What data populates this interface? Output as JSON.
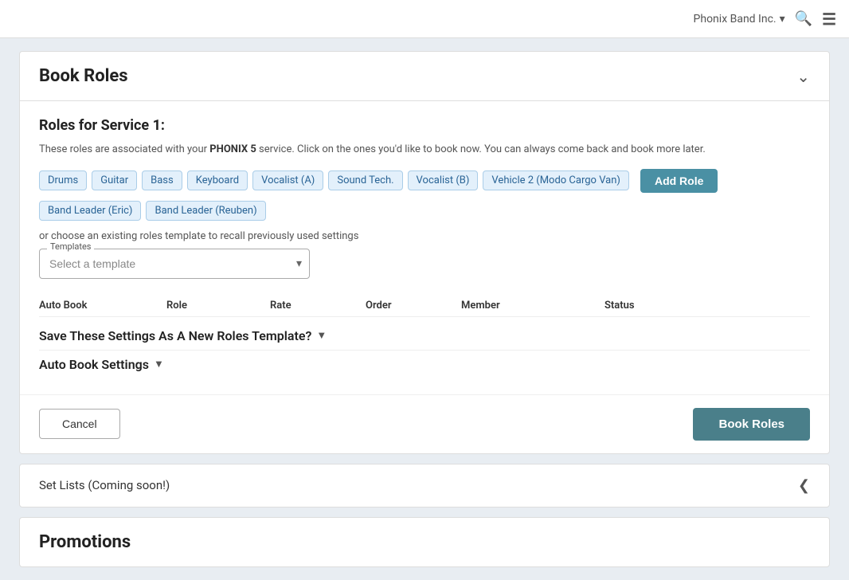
{
  "topNav": {
    "brand": "Phonix Band Inc.",
    "dropdownArrow": "▾",
    "searchIconLabel": "search",
    "menuIconLabel": "menu"
  },
  "bookRoles": {
    "cardTitle": "Book Roles",
    "sectionTitle": "Roles for Service 1:",
    "description": {
      "prefix": "These roles are associated with your ",
      "boldText": "PHONIX 5",
      "suffix": " service. Click on the ones you'd like to book now. You can always come back and book more later."
    },
    "roles": [
      "Drums",
      "Guitar",
      "Bass",
      "Keyboard",
      "Vocalist (A)",
      "Sound Tech.",
      "Vocalist (B)",
      "Vehicle 2 (Modo Cargo Van)",
      "Band Leader (Eric)",
      "Band Leader (Reuben)"
    ],
    "addRoleLabel": "Add Role",
    "templateText": "or choose an existing roles template to recall previously used settings",
    "templateSelectLabel": "Templates",
    "templateSelectPlaceholder": "Select a template",
    "tableColumns": [
      "Auto Book",
      "Role",
      "Rate",
      "Order",
      "Member",
      "Status"
    ],
    "saveSettingsLabel": "Save These Settings As A New Roles Template?",
    "autoBookSettingsLabel": "Auto Book Settings",
    "cancelLabel": "Cancel",
    "bookRolesLabel": "Book Roles"
  },
  "setLists": {
    "title": "Set Lists (Coming soon!)"
  },
  "promotions": {
    "title": "Promotions"
  }
}
